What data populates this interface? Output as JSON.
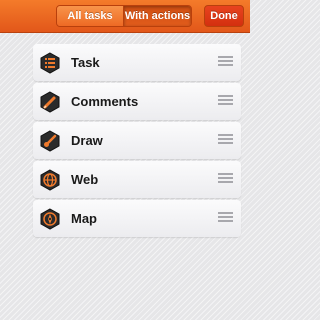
{
  "toolbar": {
    "segments": [
      {
        "label": "All tasks",
        "selected": false
      },
      {
        "label": "With actions",
        "selected": true
      }
    ],
    "done_label": "Done",
    "accent_color": "#ec6a26"
  },
  "items": [
    {
      "label": "Task",
      "icon": "task-list-icon"
    },
    {
      "label": "Comments",
      "icon": "pen-icon"
    },
    {
      "label": "Draw",
      "icon": "brush-icon"
    },
    {
      "label": "Web",
      "icon": "globe-icon"
    },
    {
      "label": "Map",
      "icon": "compass-icon"
    }
  ]
}
